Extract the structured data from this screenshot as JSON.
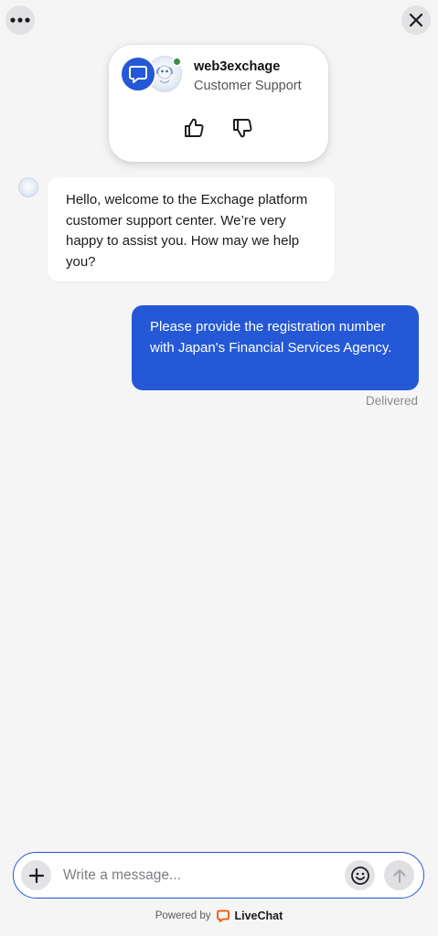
{
  "header": {
    "menu_icon": "ellipsis-icon",
    "close_icon": "close-icon"
  },
  "agent_card": {
    "name": "web3exchage",
    "role": "Customer Support",
    "status": "online",
    "brand_color": "#2458d6",
    "status_color": "#3d8a4f"
  },
  "messages": [
    {
      "direction": "incoming",
      "text": "Hello, welcome to the Exchage platform customer support center. We’re very happy to assist you. How may we help you?"
    },
    {
      "direction": "outgoing",
      "text": "Please provide the registration number with Japan's Financial Services Agency.",
      "status": "Delivered"
    }
  ],
  "composer": {
    "placeholder": "Write a message...",
    "value": ""
  },
  "footer": {
    "powered_by": "Powered by",
    "brand": "LiveChat",
    "brand_color": "#ff5100"
  }
}
